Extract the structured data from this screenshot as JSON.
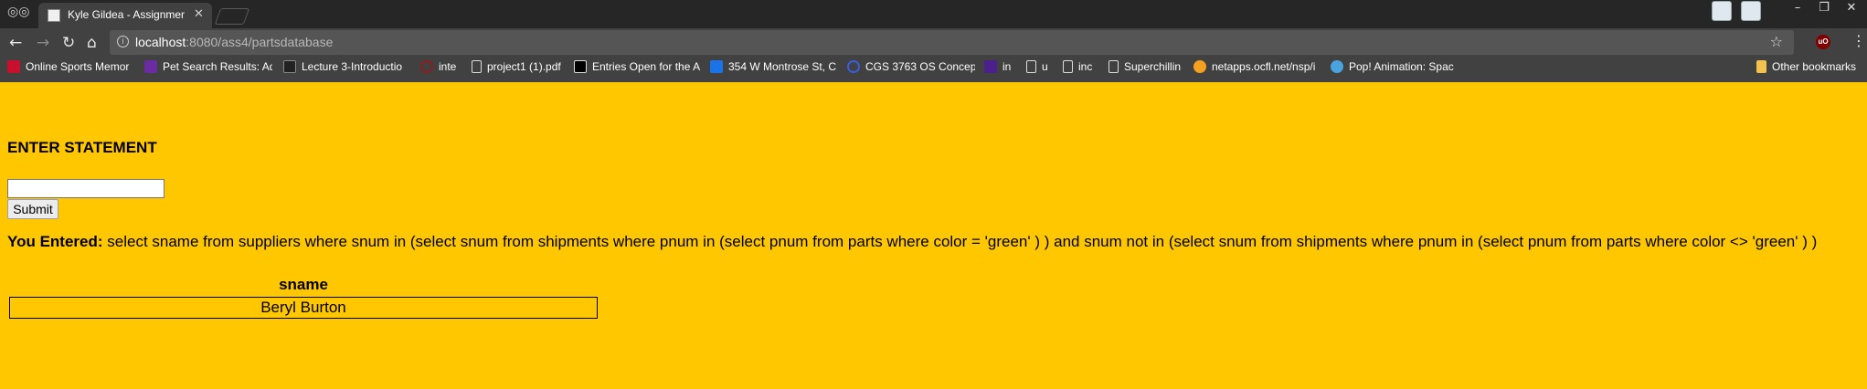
{
  "browser": {
    "tab_title": "Kyle Gildea - Assignment",
    "url_host": "localhost",
    "url_rest": ":8080/ass4/partsdatabase",
    "bookmarks": [
      {
        "label": "Online Sports Memor",
        "icon_color": "#c8102e"
      },
      {
        "label": "Pet Search Results: Ad",
        "icon_color": "#6a2ca0"
      },
      {
        "label": "Lecture 3-Introductio",
        "icon_color": "#222222"
      },
      {
        "label": "inte",
        "icon_color": "#d00000"
      },
      {
        "label": "project1 (1).pdf",
        "icon_color": "#dddddd"
      },
      {
        "label": "Entries Open for the A",
        "icon_color": "#000000"
      },
      {
        "label": "354 W Montrose St, C",
        "icon_color": "#1a73e8"
      },
      {
        "label": "CGS 3763 OS Concept",
        "icon_color": "#3b5bdb"
      },
      {
        "label": "in",
        "icon_color": "#4b1f8c"
      },
      {
        "label": "u",
        "icon_color": "#dddddd"
      },
      {
        "label": "inc",
        "icon_color": "#dddddd"
      },
      {
        "label": "Superchillin",
        "icon_color": "#dddddd"
      },
      {
        "label": "netapps.ocfl.net/nsp/i",
        "icon_color": "#f4a020"
      },
      {
        "label": "Pop! Animation: Spac",
        "icon_color": "#4aa3df"
      }
    ],
    "other_bookmarks": "Other bookmarks"
  },
  "page": {
    "heading": "ENTER STATEMENT",
    "input_value": "",
    "submit_label": "Submit",
    "entered_label": "You Entered:",
    "entered_statement": "select sname from suppliers where snum in (select snum from shipments where pnum in (select pnum from parts where color = 'green' ) ) and snum not in (select snum from shipments where pnum in (select pnum from parts where color <> 'green' ) )",
    "table": {
      "header": "sname",
      "rows": [
        "Beryl Burton"
      ]
    }
  },
  "colors": {
    "page_background": "#ffc700",
    "chrome_dark": "#414141"
  }
}
